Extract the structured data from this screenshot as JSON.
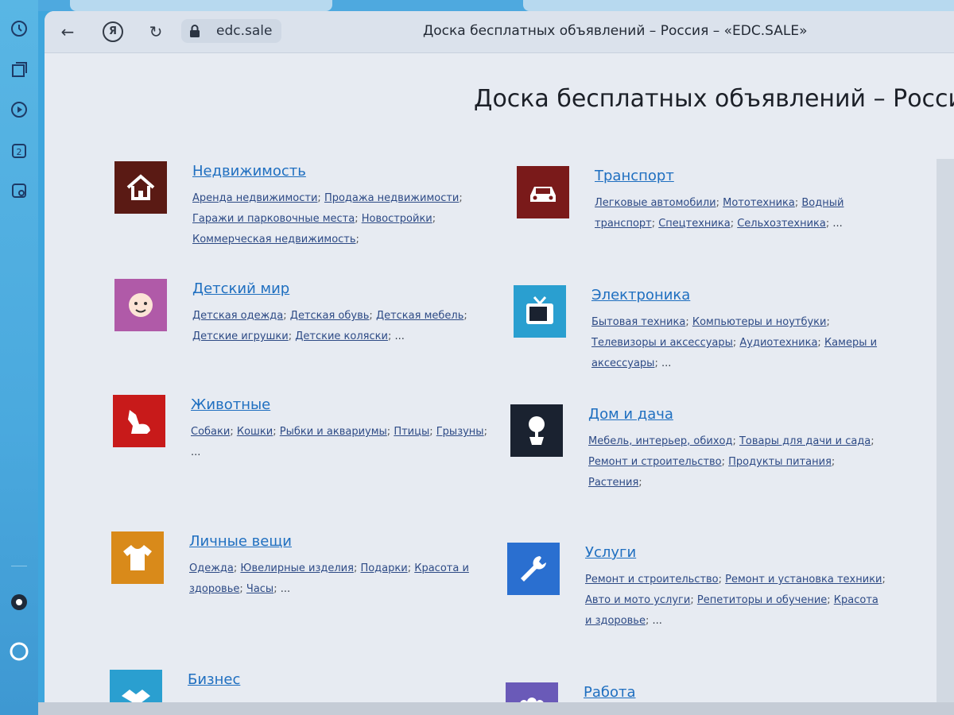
{
  "browser": {
    "url": "edc.sale",
    "tab_title": "Доска бесплатных объявлений – Россия – «EDC.SALE»",
    "sidebar_icons": [
      "history-icon",
      "collections-icon",
      "video-icon",
      "zen-icon",
      "screenshot-icon",
      "plus-icon",
      "settings-icon",
      "alice-icon"
    ]
  },
  "page": {
    "heading": "Доска бесплатных объявлений – Россия"
  },
  "categories": [
    {
      "title": "Недвижимость",
      "icon": "house-icon",
      "color": "#5a1a14",
      "links": [
        "Аренда недвижимости",
        "Продажа недвижимости",
        "Гаражи и парковочные места",
        "Новостройки",
        "Коммерческая недвижимость"
      ],
      "more": ""
    },
    {
      "title": "Транспорт",
      "icon": "car-icon",
      "color": "#7a1a1a",
      "links": [
        "Легковые автомобили",
        "Мототехника",
        "Водный транспорт",
        "Спецтехника",
        "Сельхозтехника"
      ],
      "more": "..."
    },
    {
      "title": "Детский мир",
      "icon": "baby-icon",
      "color": "#b05aa8",
      "links": [
        "Детская одежда",
        "Детская обувь",
        "Детская мебель",
        "Детские игрушки",
        "Детские коляски"
      ],
      "more": "..."
    },
    {
      "title": "Электроника",
      "icon": "tv-icon",
      "color": "#2a9fd0",
      "links": [
        "Бытовая техника",
        "Компьютеры и ноутбуки",
        "Телевизоры и аксессуары",
        "Аудиотехника",
        "Камеры и аксессуары"
      ],
      "more": "..."
    },
    {
      "title": "Животные",
      "icon": "dog-icon",
      "color": "#c81a1a",
      "links": [
        "Собаки",
        "Кошки",
        "Рыбки и аквариумы",
        "Птицы",
        "Грызуны"
      ],
      "more": "..."
    },
    {
      "title": "Дом и дача",
      "icon": "plant-icon",
      "color": "#1a2230",
      "links": [
        "Мебель, интерьер, обиход",
        "Товары для дачи и сада",
        "Ремонт и строительство",
        "Продукты питания",
        "Растения"
      ],
      "more": ""
    },
    {
      "title": "Личные вещи",
      "icon": "shirt-icon",
      "color": "#d98a1a",
      "links": [
        "Одежда",
        "Ювелирные изделия",
        "Подарки",
        "Красота и здоровье",
        "Часы"
      ],
      "more": "..."
    },
    {
      "title": "Услуги",
      "icon": "wrench-icon",
      "color": "#2a6fd0",
      "links": [
        "Ремонт и строительство",
        "Ремонт и установка техники",
        "Авто и мото услуги",
        "Репетиторы и обучение",
        "Красота и здоровье"
      ],
      "more": "..."
    },
    {
      "title": "Бизнес",
      "icon": "handshake-icon",
      "color": "#2a9fd0",
      "links": [],
      "more": ""
    },
    {
      "title": "Работа",
      "icon": "people-icon",
      "color": "#6a5ab8",
      "links": [],
      "more": ""
    }
  ]
}
